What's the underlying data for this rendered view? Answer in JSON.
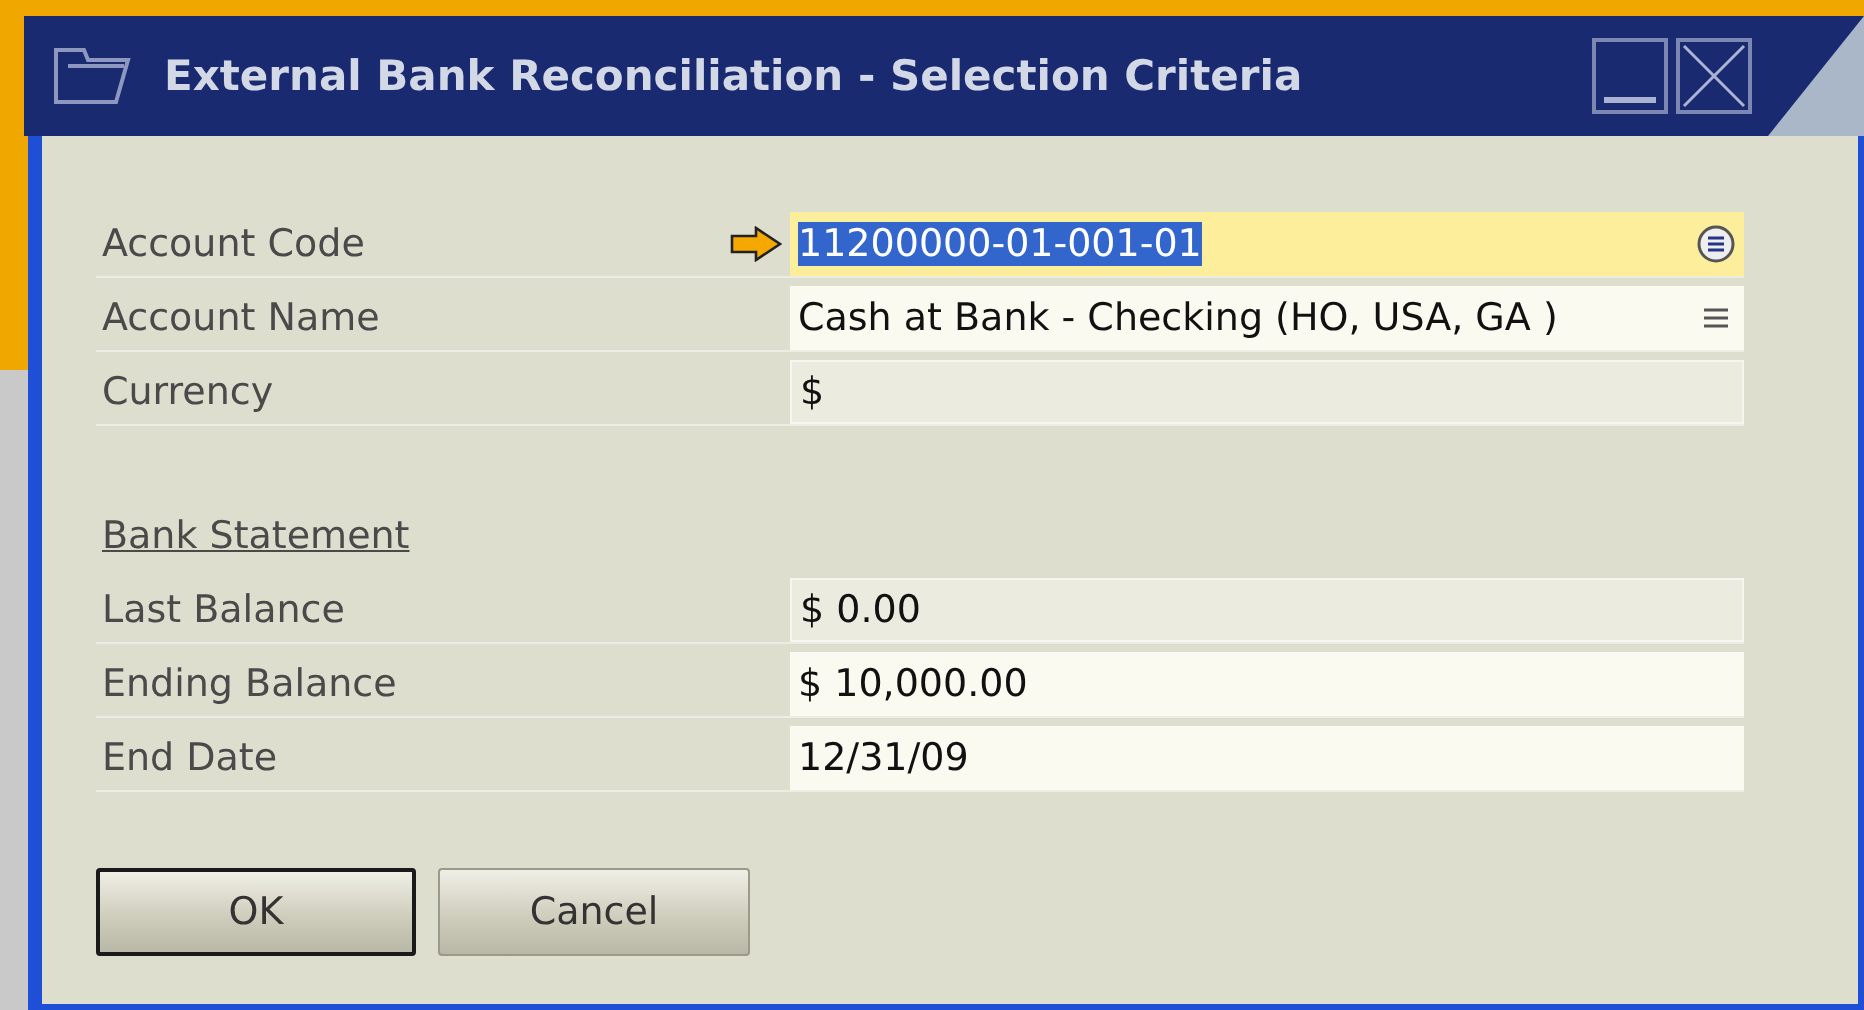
{
  "window": {
    "title": "External Bank Reconciliation - Selection Criteria"
  },
  "fields": [
    {
      "label": "Account Code",
      "value": "11200000-01-001-01",
      "kind": "choose",
      "focused": true,
      "disabled": false
    },
    {
      "label": "Account Name",
      "value": "Cash at Bank - Checking (HO, USA, GA )",
      "kind": "link",
      "focused": false,
      "disabled": false
    },
    {
      "label": "Currency",
      "value": "$",
      "kind": "plain",
      "focused": false,
      "disabled": true
    }
  ],
  "section": {
    "heading": "Bank Statement"
  },
  "statement_fields": [
    {
      "label": "Last Balance",
      "value": "$ 0.00",
      "focused": false,
      "disabled": true
    },
    {
      "label": "Ending Balance",
      "value": "$ 10,000.00",
      "focused": false,
      "disabled": false
    },
    {
      "label": "End Date",
      "value": "12/31/09",
      "focused": false,
      "disabled": false
    }
  ],
  "buttons": [
    {
      "label": "OK",
      "default": true
    },
    {
      "label": "Cancel",
      "default": false
    }
  ]
}
